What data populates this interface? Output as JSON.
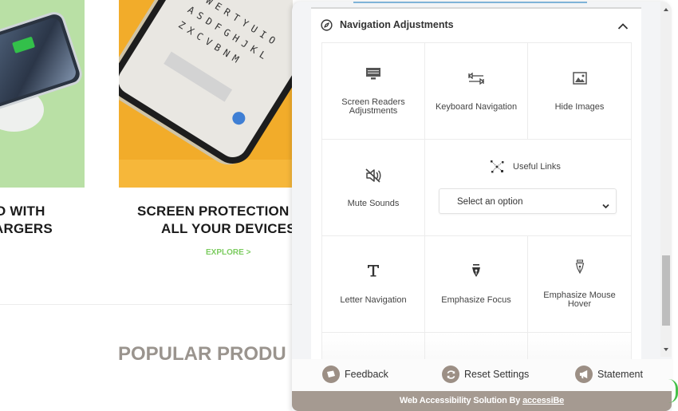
{
  "site": {
    "card_left": {
      "title_line1": "O WITH",
      "title_line2": "ARGERS"
    },
    "card_middle": {
      "title_line1": "SCREEN PROTECTION F",
      "title_line2": "ALL YOUR DEVICES",
      "explore_link": "EXPLORE >"
    },
    "keyboard_rows": [
      "QWERTYUIO",
      "ASDFGHJKL",
      "ZXCVBNM"
    ],
    "popular_heading": "POPULAR PRODU"
  },
  "panel": {
    "section": {
      "icon": "compass-icon",
      "title": "Navigation Adjustments",
      "collapse_icon": "chevron-up-icon"
    },
    "tiles": [
      {
        "icon": "monitor-icon",
        "label": "Screen Readers Adjustments"
      },
      {
        "icon": "keyboard-arrows-icon",
        "label": "Keyboard Navigation"
      },
      {
        "icon": "image-icon",
        "label": "Hide Images"
      },
      {
        "icon": "mute-speaker-icon",
        "label": "Mute Sounds"
      },
      {
        "icon": "network-links-icon",
        "label": "Useful Links"
      },
      {
        "icon": "letter-t-icon",
        "label": "Letter Navigation"
      },
      {
        "icon": "pen-nib-filled-icon",
        "label": "Emphasize Focus"
      },
      {
        "icon": "pen-nib-outline-icon",
        "label": "Emphasize Mouse Hover"
      }
    ],
    "useful_links_select": {
      "selected": "Select an option"
    },
    "footer": {
      "feedback": "Feedback",
      "reset": "Reset Settings",
      "statement": "Statement"
    },
    "brand": {
      "prefix": "Web Accessibility Solution By ",
      "link": "accessiBe"
    }
  },
  "colors": {
    "brand_gray": "#a59a91",
    "icon_circle": "#9c8f85",
    "explore_green": "#7ccc60",
    "popular_gray": "#9a948e"
  }
}
